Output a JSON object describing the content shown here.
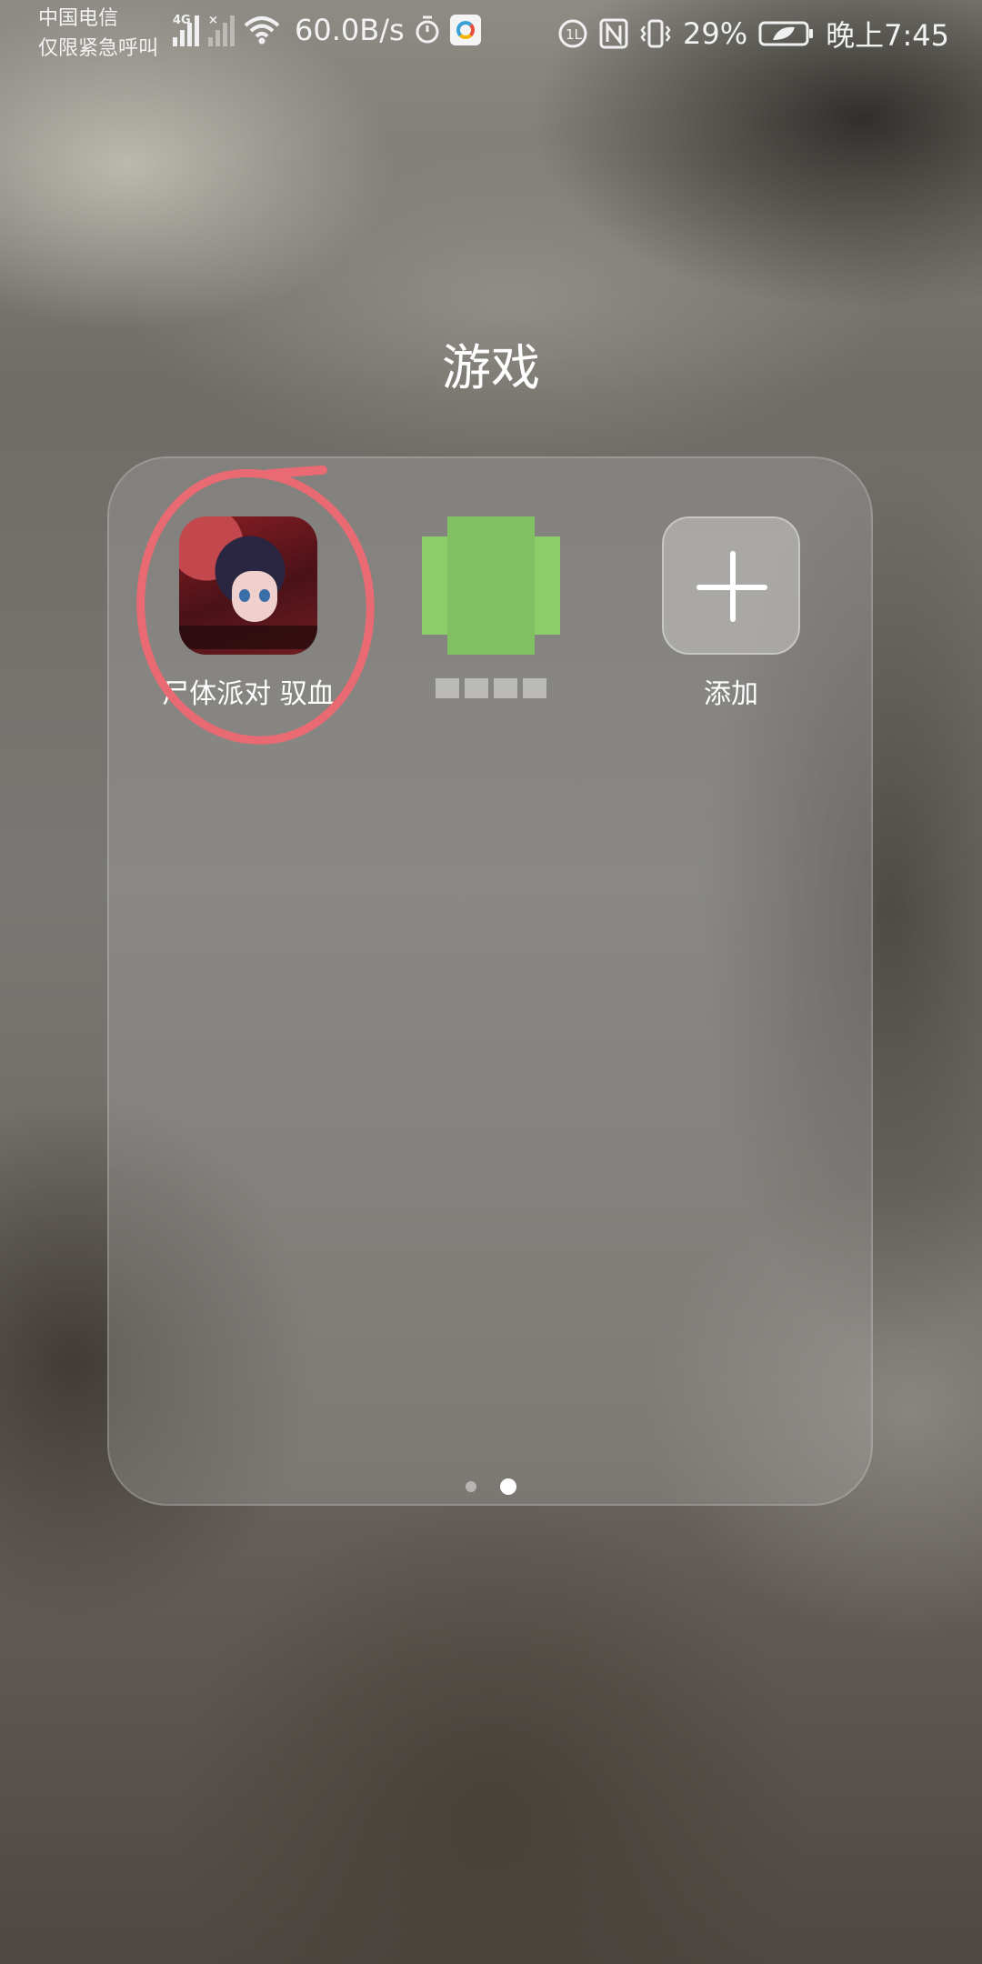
{
  "status_bar": {
    "carrier_line1": "中国电信",
    "carrier_line2": "仅限紧急呼叫",
    "network_type": "4G",
    "net_speed": "60.0B/s",
    "battery": "29%",
    "time": "晚上7:45",
    "icons": [
      "signal-4g-icon",
      "signal-no-sim-icon",
      "wifi-icon",
      "timer-icon",
      "app-notification-icon",
      "hd-call-icon",
      "nfc-icon",
      "vibrate-icon",
      "battery-icon"
    ]
  },
  "folder": {
    "title": "游戏",
    "apps": [
      {
        "name": "尸体派对 驭血",
        "icon": "game-app-icon"
      },
      {
        "name": "",
        "icon": "pixelated-app-icon"
      },
      {
        "name": "添加",
        "icon": "add-icon"
      }
    ],
    "page_indicator": {
      "pages": 2,
      "current": 2
    }
  },
  "annotation": {
    "color": "#e96a72"
  }
}
